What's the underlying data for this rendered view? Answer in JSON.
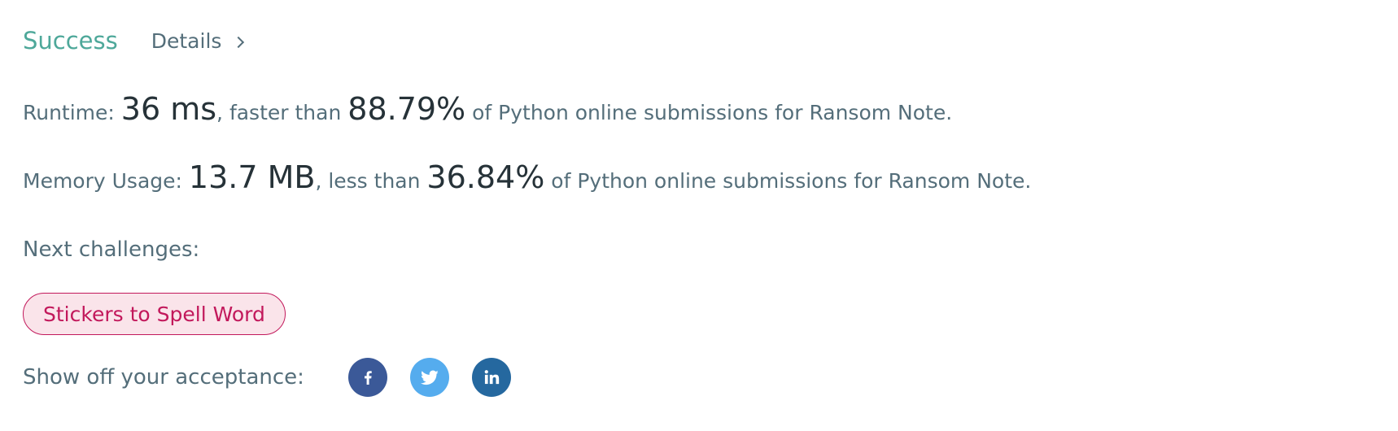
{
  "header": {
    "status": "Success",
    "details_label": "Details"
  },
  "runtime": {
    "label": "Runtime: ",
    "value": "36 ms",
    "comparison": ", faster than ",
    "percent": "88.79%",
    "suffix": " of Python online submissions for Ransom Note."
  },
  "memory": {
    "label": "Memory Usage: ",
    "value": "13.7 MB",
    "comparison": ", less than ",
    "percent": "36.84%",
    "suffix": " of Python online submissions for Ransom Note."
  },
  "next_challenges": {
    "label": "Next challenges:",
    "items": [
      {
        "label": "Stickers to Spell Word"
      }
    ]
  },
  "share": {
    "label": "Show off your acceptance:",
    "icons": [
      "facebook-icon",
      "twitter-icon",
      "linkedin-icon"
    ]
  },
  "colors": {
    "success": "#4ea89a",
    "text": "#546e7a",
    "emphasis": "#263238",
    "chip_border": "#c2185b",
    "chip_background": "#fae4ea",
    "facebook": "#3b5998",
    "twitter": "#55acee",
    "linkedin": "#25689f"
  }
}
